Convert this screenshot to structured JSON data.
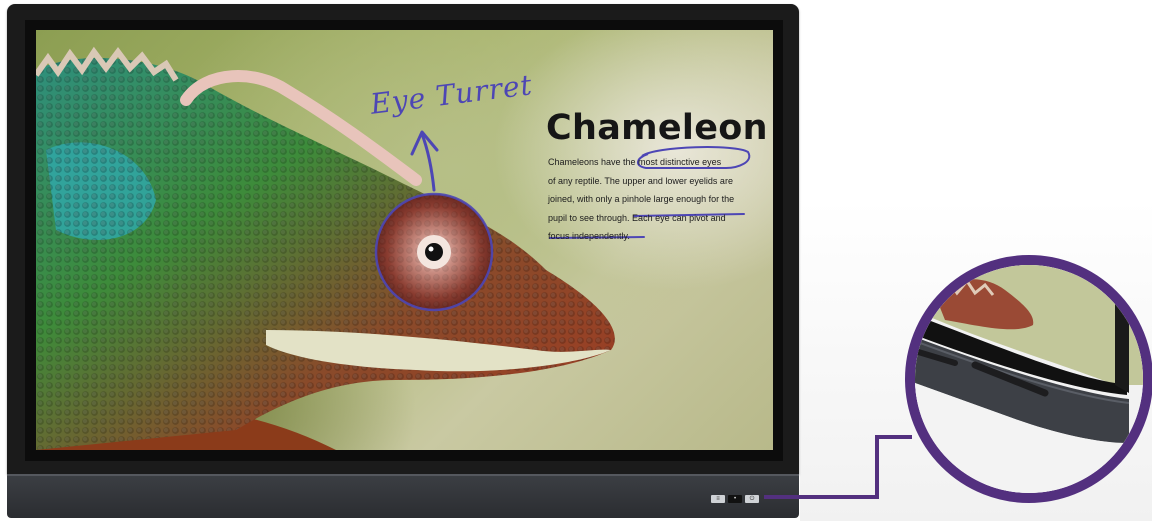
{
  "slide": {
    "title": "Chameleon",
    "body_lines": [
      "Chameleons have the most distinctive eyes",
      "of any reptile. The upper and lower eyelids are",
      "joined, with only a pinhole large enough for the",
      "pupil to see through. Each eye can pivot and",
      "focus independently."
    ]
  },
  "annotation": {
    "handwritten_label": "Eye Turret",
    "ink_color": "#4d46b5"
  },
  "zoom_inset": {
    "ring_color": "#53307f",
    "connector_color": "#53307f"
  },
  "icons": [
    "eye-icon",
    "speaker-grille",
    "power-button",
    "input-button"
  ]
}
